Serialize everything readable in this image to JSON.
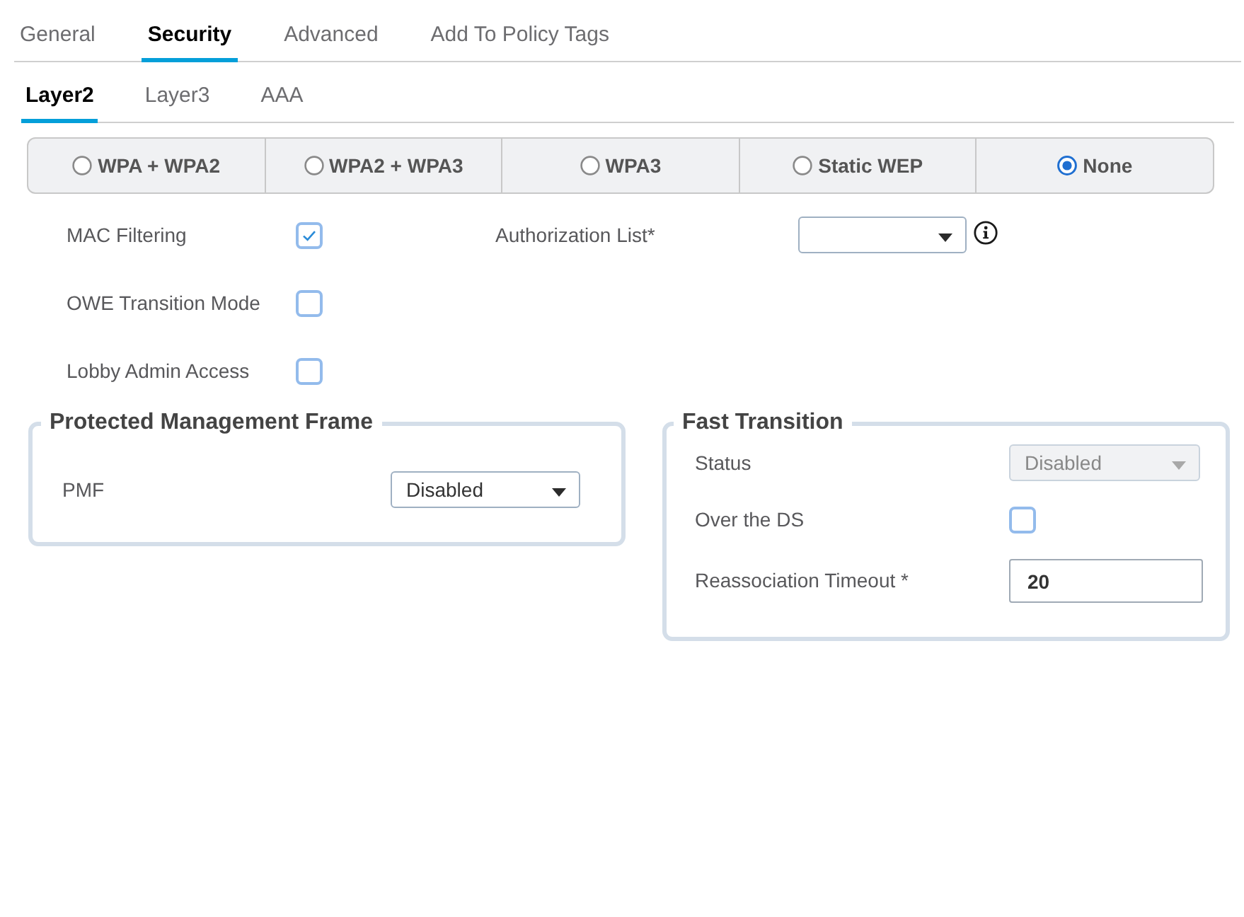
{
  "tabs": [
    {
      "label": "General",
      "selected": false
    },
    {
      "label": "Security",
      "selected": true
    },
    {
      "label": "Advanced",
      "selected": false
    },
    {
      "label": "Add To Policy Tags",
      "selected": false
    }
  ],
  "sub_tabs": [
    {
      "label": "Layer2",
      "selected": true
    },
    {
      "label": "Layer3",
      "selected": false
    },
    {
      "label": "AAA",
      "selected": false
    }
  ],
  "security_modes": [
    {
      "label": "WPA + WPA2",
      "selected": false
    },
    {
      "label": "WPA2 + WPA3",
      "selected": false
    },
    {
      "label": "WPA3",
      "selected": false
    },
    {
      "label": "Static WEP",
      "selected": false
    },
    {
      "label": "None",
      "selected": true
    }
  ],
  "options": [
    {
      "label": "MAC Filtering",
      "checked": true
    },
    {
      "label": "OWE Transition Mode",
      "checked": false
    },
    {
      "label": "Lobby Admin Access",
      "checked": false
    }
  ],
  "authorization_list": {
    "label": "Authorization List*"
  },
  "sections": [
    {
      "title": "Protected Management Frame",
      "fields": [
        {
          "kind": "select",
          "label": "PMF",
          "value": "Disabled",
          "disabled": false
        }
      ]
    },
    {
      "title": "Fast Transition",
      "fields": [
        {
          "kind": "select",
          "label": "Status",
          "value": "Disabled",
          "disabled": true
        },
        {
          "kind": "checkbox",
          "label": "Over the DS",
          "checked": false
        },
        {
          "kind": "input",
          "label": "Reassociation Timeout *",
          "value": "20"
        }
      ]
    }
  ]
}
